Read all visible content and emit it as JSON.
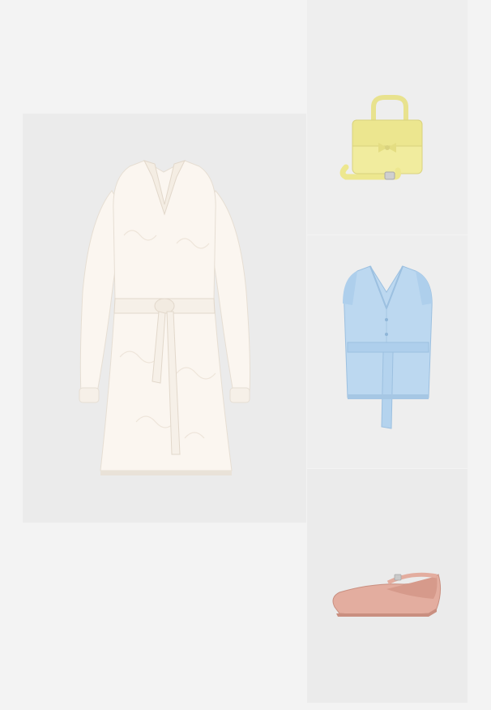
{
  "outfit": {
    "items": [
      {
        "name": "white-embroidered-dress",
        "colors": {
          "primary": "#fbf6f0",
          "shadow": "#e9e2d8"
        }
      },
      {
        "name": "yellow-handbag",
        "colors": {
          "primary": "#f1ec9e",
          "shadow": "#d9d27e"
        }
      },
      {
        "name": "light-denim-vest-top",
        "colors": {
          "primary": "#bcd8f0",
          "shadow": "#8fb6d8"
        }
      },
      {
        "name": "pink-ballet-flats",
        "colors": {
          "primary": "#e3ad9f",
          "shadow": "#c98f80"
        }
      }
    ]
  },
  "colors": {
    "page_background": "#f3f3f3",
    "panel_background": "#ebebeb"
  }
}
